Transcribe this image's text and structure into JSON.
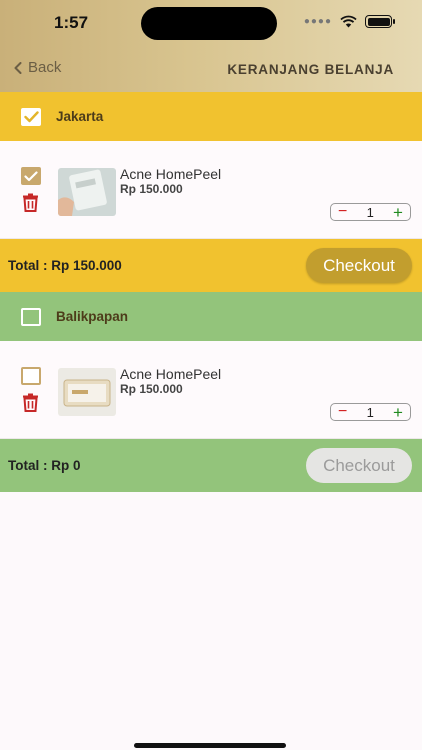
{
  "status": {
    "time": "1:57"
  },
  "header": {
    "back_label": "Back",
    "title": "KERANJANG BELANJA"
  },
  "groups": [
    {
      "name": "Jakarta",
      "checked": true,
      "color": "#f1c22f",
      "item": {
        "name": "Acne HomePeel",
        "price": "Rp 150.000",
        "qty": "1",
        "checked": true
      },
      "total_label": "Total : Rp 150.000",
      "checkout_label": "Checkout",
      "checkout_enabled": true
    },
    {
      "name": "Balikpapan",
      "checked": false,
      "color": "#93c47b",
      "item": {
        "name": "Acne HomePeel",
        "price": "Rp 150.000",
        "qty": "1",
        "checked": false
      },
      "total_label": "Total : Rp 0",
      "checkout_label": "Checkout",
      "checkout_enabled": false
    }
  ],
  "colors": {
    "accent_gold": "#c29e2e",
    "trash_red": "#c62828",
    "checkbox_tan": "#c8a86d"
  },
  "icons": {
    "back": "chevron-left-icon",
    "trash": "trash-icon",
    "check": "check-icon",
    "wifi": "wifi-icon",
    "battery": "battery-icon"
  }
}
